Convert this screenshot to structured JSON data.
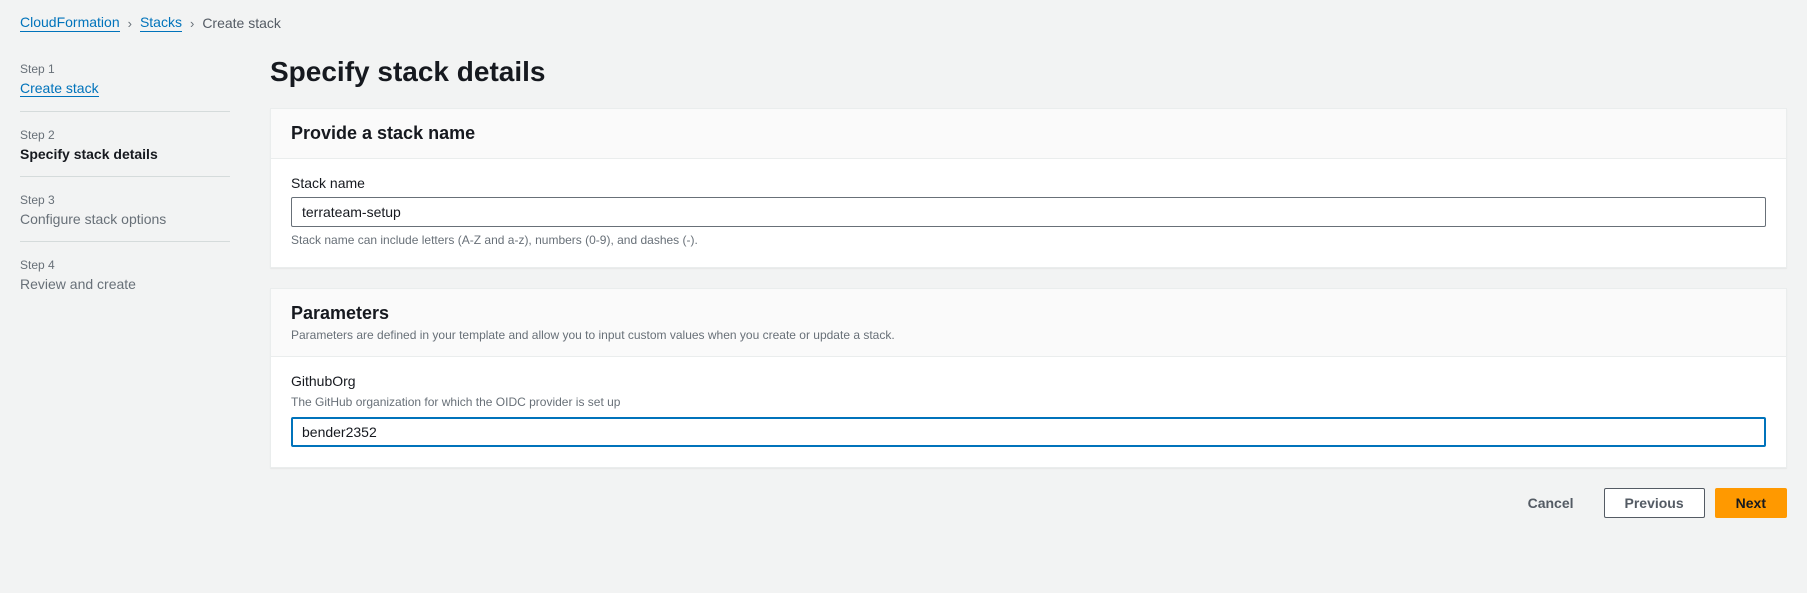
{
  "breadcrumb": {
    "root": "CloudFormation",
    "stacks": "Stacks",
    "current": "Create stack"
  },
  "sidebar": {
    "steps": [
      {
        "label": "Step 1",
        "title": "Create stack"
      },
      {
        "label": "Step 2",
        "title": "Specify stack details"
      },
      {
        "label": "Step 3",
        "title": "Configure stack options"
      },
      {
        "label": "Step 4",
        "title": "Review and create"
      }
    ]
  },
  "page": {
    "title": "Specify stack details"
  },
  "stackNamePanel": {
    "header": "Provide a stack name",
    "fieldLabel": "Stack name",
    "value": "terrateam-setup",
    "hint": "Stack name can include letters (A-Z and a-z), numbers (0-9), and dashes (-)."
  },
  "parametersPanel": {
    "header": "Parameters",
    "subtitle": "Parameters are defined in your template and allow you to input custom values when you create or update a stack.",
    "param1": {
      "label": "GithubOrg",
      "desc": "The GitHub organization for which the OIDC provider is set up",
      "value": "bender2352"
    }
  },
  "buttons": {
    "cancel": "Cancel",
    "previous": "Previous",
    "next": "Next"
  }
}
